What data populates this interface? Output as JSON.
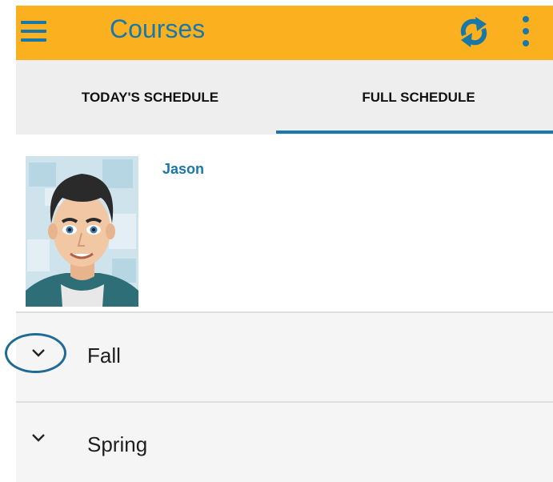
{
  "appbar": {
    "title": "Courses",
    "menu_icon": "hamburger-menu-icon",
    "sync_icon": "sync-icon",
    "more_icon": "more-vert-icon"
  },
  "tabs": [
    {
      "label": "TODAY'S SCHEDULE",
      "selected": false
    },
    {
      "label": "FULL SCHEDULE",
      "selected": true
    }
  ],
  "profile": {
    "name": "Jason"
  },
  "terms": [
    {
      "label": "Fall",
      "expanded": false,
      "highlighted": true
    },
    {
      "label": "Spring",
      "expanded": false,
      "highlighted": false
    }
  ],
  "colors": {
    "appbar_bg": "#fbb01f",
    "accent": "#1a78a8",
    "tabs_bg": "#eeeeee",
    "row_bg": "#f5f5f5"
  }
}
